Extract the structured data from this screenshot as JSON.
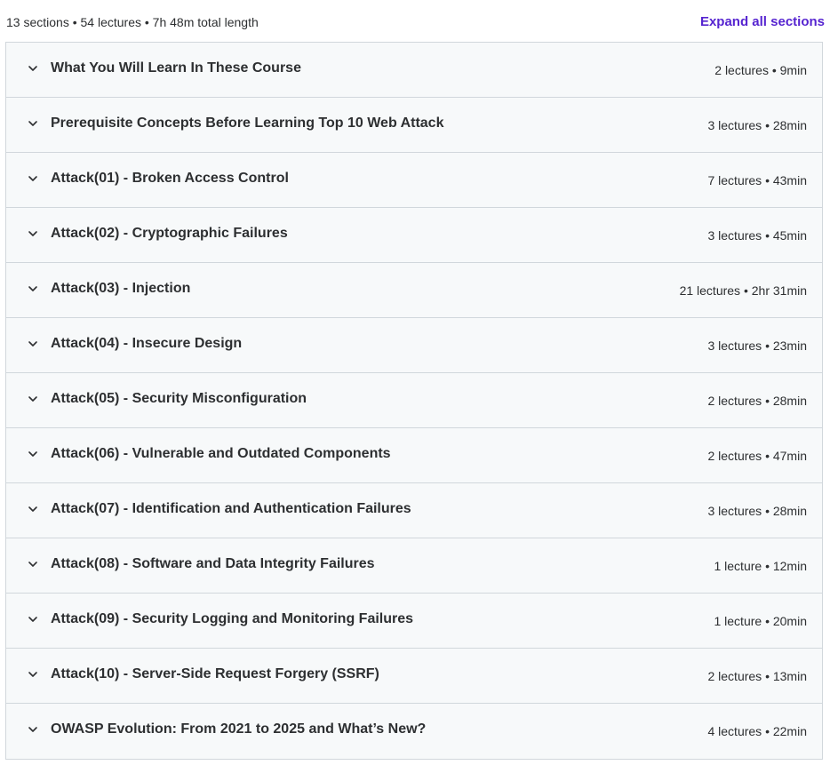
{
  "curriculum": {
    "summary": "13 sections • 54 lectures • 7h 48m total length",
    "expand_all_label": "Expand all sections",
    "accent_color": "#5624d0",
    "section_icon": "chevron-down-icon",
    "sections": [
      {
        "title": "What You Will Learn In These Course",
        "meta": "2 lectures • 9min"
      },
      {
        "title": "Prerequisite Concepts Before Learning Top 10 Web Attack",
        "meta": "3 lectures • 28min"
      },
      {
        "title": "Attack(01) - Broken Access Control",
        "meta": "7 lectures • 43min"
      },
      {
        "title": "Attack(02) - Cryptographic Failures",
        "meta": "3 lectures • 45min"
      },
      {
        "title": "Attack(03) - Injection",
        "meta": "21 lectures • 2hr 31min"
      },
      {
        "title": "Attack(04) - Insecure Design",
        "meta": "3 lectures • 23min"
      },
      {
        "title": "Attack(05) - Security Misconfiguration",
        "meta": "2 lectures • 28min"
      },
      {
        "title": "Attack(06) - Vulnerable and Outdated Components",
        "meta": "2 lectures • 47min"
      },
      {
        "title": "Attack(07) - Identification and Authentication Failures",
        "meta": "3 lectures • 28min"
      },
      {
        "title": "Attack(08) - Software and Data Integrity Failures",
        "meta": "1 lecture • 12min"
      },
      {
        "title": "Attack(09) - Security Logging and Monitoring Failures",
        "meta": "1 lecture • 20min"
      },
      {
        "title": "Attack(10) - Server-Side Request Forgery (SSRF)",
        "meta": "2 lectures • 13min"
      },
      {
        "title": "OWASP Evolution: From 2021 to 2025 and What’s New?",
        "meta": "4 lectures • 22min"
      }
    ]
  }
}
